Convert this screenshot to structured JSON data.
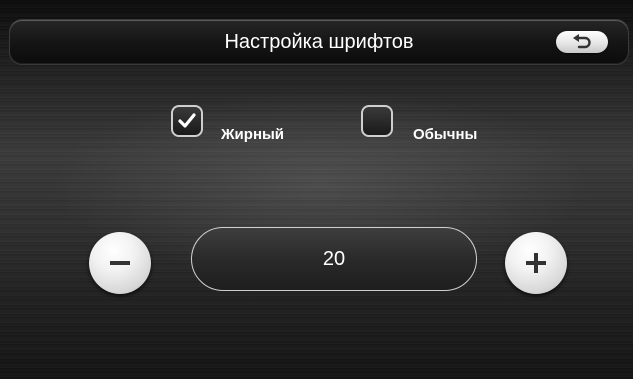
{
  "header": {
    "title": "Настройка шрифтов",
    "back_icon": "return-arrow-icon"
  },
  "font_style": {
    "options": [
      {
        "label": "Жирный",
        "checked": true
      },
      {
        "label": "Обычны",
        "checked": false
      }
    ]
  },
  "font_size": {
    "value": "20",
    "decrease_icon": "minus-icon",
    "increase_icon": "plus-icon"
  },
  "colors": {
    "text": "#ffffff",
    "button_face": "#e6e6e6",
    "icon": "#333333"
  }
}
